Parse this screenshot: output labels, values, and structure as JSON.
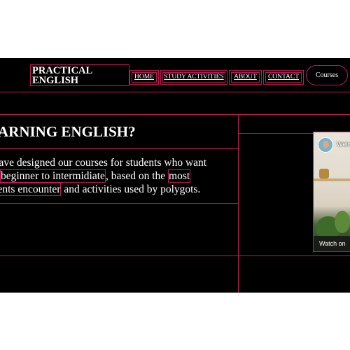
{
  "header": {
    "logo_line1": "PRACTICAL",
    "logo_line2": "ENGLISH",
    "nav": [
      "HOME",
      "STUDY ACTIVITIES",
      "ABOUT",
      "CONTACT"
    ],
    "courses_label": "Courses"
  },
  "main": {
    "heading": "EARNING ENGLISH?",
    "para_line1": "e have designed our courses for students who want",
    "para_l2_a": "beginner to intermidiate",
    "para_l2_b": ", based on the ",
    "para_l2_c": "most",
    "para_l3_a": "udents encounter",
    "para_l3_b": " and activities used by polygots."
  },
  "video": {
    "title_partial": "Welc",
    "watch_label": "Watch on"
  },
  "colors": {
    "background": "#000000",
    "outline": "#c2185b",
    "text": "#ffffff"
  }
}
